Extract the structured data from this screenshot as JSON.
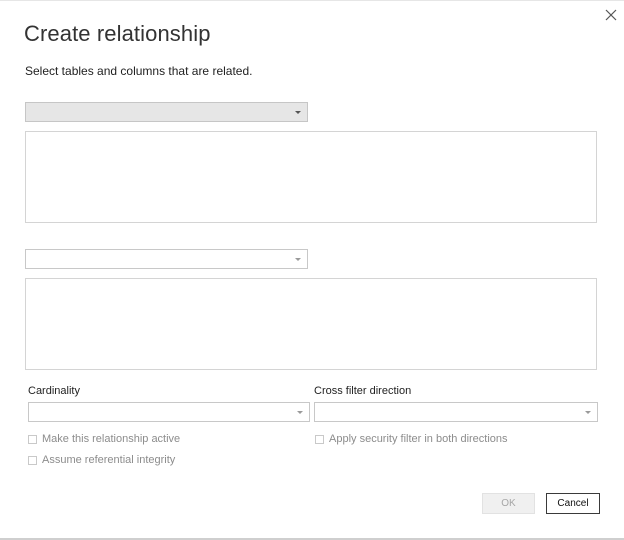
{
  "dialog": {
    "title": "Create relationship",
    "subtitle": "Select tables and columns that are related.",
    "close_icon": "close-icon"
  },
  "table1": {
    "selected": "",
    "style": "filled"
  },
  "table2": {
    "selected": ""
  },
  "cardinality": {
    "label": "Cardinality",
    "selected": ""
  },
  "cross_filter": {
    "label": "Cross filter direction",
    "selected": ""
  },
  "options": {
    "active_label": "Make this relationship active",
    "referential_label": "Assume referential integrity",
    "security_label": "Apply security filter in both directions"
  },
  "buttons": {
    "ok": "OK",
    "cancel": "Cancel"
  }
}
